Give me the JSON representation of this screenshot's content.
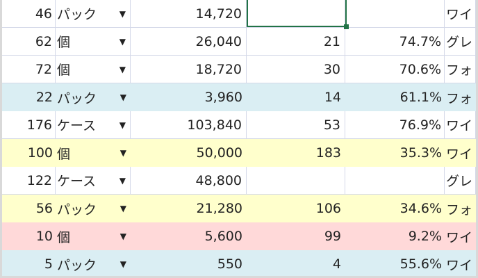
{
  "colors": {
    "blue": "#daeef3",
    "yellow": "#ffffcc",
    "pink": "#ffd9d9",
    "white": "#ffffff",
    "selection": "#217346"
  },
  "rows": [
    {
      "qty": "46",
      "unit": "パック",
      "amount": "14,720",
      "count": "",
      "rate": "",
      "name": "ワイ",
      "bg": "white"
    },
    {
      "qty": "62",
      "unit": "個",
      "amount": "26,040",
      "count": "21",
      "rate": "74.7%",
      "name": "グレ",
      "bg": "white"
    },
    {
      "qty": "72",
      "unit": "個",
      "amount": "18,720",
      "count": "30",
      "rate": "70.6%",
      "name": "フォ",
      "bg": "white"
    },
    {
      "qty": "22",
      "unit": "パック",
      "amount": "3,960",
      "count": "14",
      "rate": "61.1%",
      "name": "フォ",
      "bg": "blue"
    },
    {
      "qty": "176",
      "unit": "ケース",
      "amount": "103,840",
      "count": "53",
      "rate": "76.9%",
      "name": "ワイ",
      "bg": "white"
    },
    {
      "qty": "100",
      "unit": "個",
      "amount": "50,000",
      "count": "183",
      "rate": "35.3%",
      "name": "ワイ",
      "bg": "yellow"
    },
    {
      "qty": "122",
      "unit": "ケース",
      "amount": "48,800",
      "count": "",
      "rate": "",
      "name": "グレ",
      "bg": "white"
    },
    {
      "qty": "56",
      "unit": "パック",
      "amount": "21,280",
      "count": "106",
      "rate": "34.6%",
      "name": "フォ",
      "bg": "yellow"
    },
    {
      "qty": "10",
      "unit": "個",
      "amount": "5,600",
      "count": "99",
      "rate": "9.2%",
      "name": "ワイ",
      "bg": "pink"
    },
    {
      "qty": "5",
      "unit": "パック",
      "amount": "550",
      "count": "4",
      "rate": "55.6%",
      "name": "ワイ",
      "bg": "blue"
    }
  ],
  "dropdown_arrow": "▼"
}
